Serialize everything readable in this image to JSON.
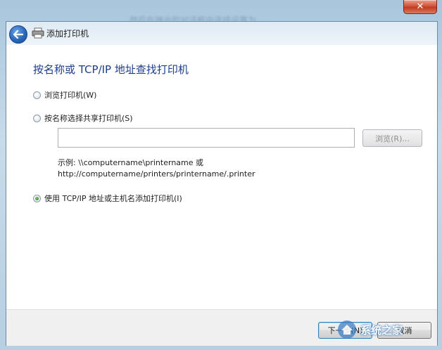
{
  "window": {
    "blurred_title": "……然后在弹出的对话框中选择设置为……",
    "close_glyph": "✕"
  },
  "wizard": {
    "title": "添加打印机",
    "heading": "按名称或 TCP/IP 地址查找打印机"
  },
  "options": [
    {
      "label": "浏览打印机(W)",
      "checked": false
    },
    {
      "label": "按名称选择共享打印机(S)",
      "checked": false
    },
    {
      "label": "使用 TCP/IP 地址或主机名添加打印机(I)",
      "checked": true
    }
  ],
  "share_input": {
    "value": "",
    "placeholder": ""
  },
  "browse_button": {
    "label": "浏览(R)...",
    "enabled": false
  },
  "example": {
    "line1": "示例: \\\\computername\\printername 或",
    "line2": "http://computername/printers/printername/.printer"
  },
  "footer": {
    "next_label": "下一步(N)",
    "cancel_label": "取消"
  },
  "watermark": {
    "text": "系统之家"
  },
  "colors": {
    "heading": "#1e3e8a",
    "close_button": "#c13b22",
    "back_button": "#2a66bd"
  },
  "icons": {
    "back": "back-arrow-icon",
    "printer": "printer-icon",
    "close": "close-icon"
  }
}
